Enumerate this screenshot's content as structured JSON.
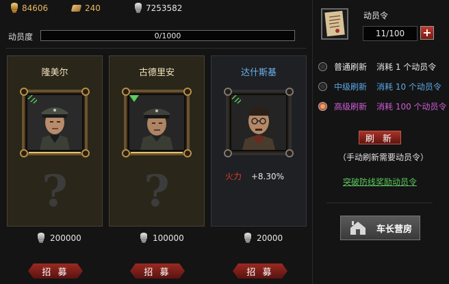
{
  "resources": {
    "gold": "84606",
    "scrolls": "240",
    "silver": "7253582"
  },
  "mobilization": {
    "label": "动员度",
    "progress_text": "0/1000",
    "progress": 0
  },
  "cards": [
    {
      "name": "隆美尔",
      "name_color": "#f0e3c0",
      "price": "200000",
      "recruit_label": "招 募"
    },
    {
      "name": "古德里安",
      "name_color": "#f0e3c0",
      "price": "100000",
      "recruit_label": "招 募"
    },
    {
      "name": "达什斯基",
      "name_color": "#6cb4ef",
      "stat_label": "火力",
      "stat_value": "+8.30%",
      "price": "20000",
      "recruit_label": "招 募"
    }
  ],
  "order": {
    "title": "动员令",
    "count": "11/100",
    "plus": "+"
  },
  "refresh_options": [
    {
      "name": "普通刷新",
      "cost": "消耗 1 个动员令",
      "name_color": "#e8e8e8",
      "cost_color": "#e8e8e8",
      "selected": false
    },
    {
      "name": "中级刷新",
      "cost": "消耗 10 个动员令",
      "name_color": "#5aa8e8",
      "cost_color": "#5aa8e8",
      "selected": false
    },
    {
      "name": "高级刷新",
      "cost": "消耗 100 个动员令",
      "name_color": "#d05cd8",
      "cost_color": "#d05cd8",
      "selected": true
    }
  ],
  "refresh_button": "刷 新",
  "refresh_note": "（手动刷新需要动员令）",
  "breakthrough_link": "突破防线奖励动员令",
  "barracks_button": "车长营房",
  "colors": {
    "accent_red": "#a83228",
    "gold_text": "#f0e3c0",
    "link_green": "#5cc85c"
  }
}
